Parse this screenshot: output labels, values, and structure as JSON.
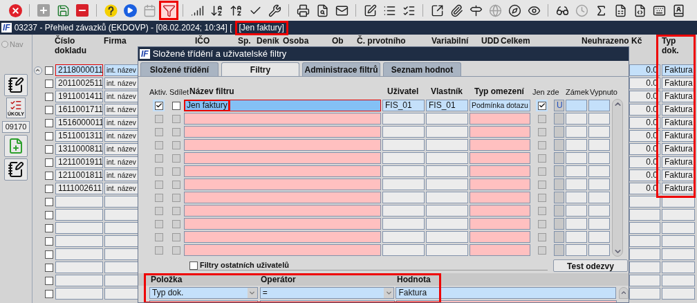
{
  "toolbar": {
    "items": [
      {
        "kind": "icon",
        "disabled": false,
        "highlighted": false
      },
      {
        "kind": "separator"
      },
      {
        "kind": "icon",
        "disabled": true,
        "highlighted": false
      },
      {
        "kind": "icon",
        "disabled": false,
        "highlighted": false
      },
      {
        "kind": "icon",
        "disabled": false,
        "highlighted": false
      },
      {
        "kind": "separator"
      },
      {
        "kind": "icon",
        "disabled": false,
        "highlighted": false
      },
      {
        "kind": "icon",
        "disabled": false,
        "highlighted": false
      },
      {
        "kind": "icon",
        "disabled": true,
        "highlighted": false
      },
      {
        "kind": "icon",
        "disabled": false,
        "highlighted": true
      },
      {
        "kind": "separator"
      },
      {
        "kind": "icon",
        "disabled": false,
        "highlighted": false
      },
      {
        "kind": "icon",
        "disabled": false,
        "highlighted": false
      },
      {
        "kind": "icon",
        "disabled": false,
        "highlighted": false
      },
      {
        "kind": "icon",
        "disabled": false,
        "highlighted": false
      },
      {
        "kind": "icon",
        "disabled": false,
        "highlighted": false
      },
      {
        "kind": "separator"
      },
      {
        "kind": "icon",
        "disabled": false,
        "highlighted": false
      },
      {
        "kind": "icon",
        "disabled": false,
        "highlighted": false
      },
      {
        "kind": "icon",
        "disabled": false,
        "highlighted": false
      },
      {
        "kind": "separator"
      },
      {
        "kind": "icon",
        "disabled": false,
        "highlighted": false
      },
      {
        "kind": "icon",
        "disabled": false,
        "highlighted": false
      },
      {
        "kind": "icon",
        "disabled": false,
        "highlighted": false
      },
      {
        "kind": "separator"
      },
      {
        "kind": "icon",
        "disabled": false,
        "highlighted": false
      },
      {
        "kind": "icon",
        "disabled": false,
        "highlighted": false
      },
      {
        "kind": "icon",
        "disabled": false,
        "highlighted": false
      },
      {
        "kind": "icon",
        "disabled": true,
        "highlighted": false
      },
      {
        "kind": "icon",
        "disabled": false,
        "highlighted": false
      },
      {
        "kind": "icon",
        "disabled": false,
        "highlighted": false
      },
      {
        "kind": "separator"
      },
      {
        "kind": "icon",
        "disabled": false,
        "highlighted": false
      },
      {
        "kind": "icon",
        "disabled": true,
        "highlighted": false
      },
      {
        "kind": "icon",
        "disabled": false,
        "highlighted": false
      },
      {
        "kind": "icon",
        "disabled": false,
        "highlighted": false
      },
      {
        "kind": "icon",
        "disabled": false,
        "highlighted": false
      },
      {
        "kind": "icon",
        "disabled": false,
        "highlighted": false
      },
      {
        "kind": "icon",
        "disabled": false,
        "highlighted": false
      }
    ]
  },
  "title_bar": {
    "logo": "IF",
    "title": "03237 - Přehled závazků (EKDOVP) - [08.02.2024; 10:34] [",
    "filter_label": "[Jen faktury]",
    "filter_highlighted": true
  },
  "sidebar": {
    "nav_label": "Nav",
    "nav_disabled": true,
    "tasks_label": "ÚKOLY",
    "code": "09170"
  },
  "table": {
    "columns": [
      {
        "label": "Číslo dokladu",
        "highlighted": false
      },
      {
        "label": "Firma",
        "highlighted": false
      },
      {
        "label": "IČO",
        "highlighted": false
      },
      {
        "label": "Sp.",
        "highlighted": false
      },
      {
        "label": "Deník",
        "highlighted": false
      },
      {
        "label": "Osoba",
        "highlighted": false
      },
      {
        "label": "Ob",
        "highlighted": false
      },
      {
        "label": "Č. prvotního",
        "highlighted": false
      },
      {
        "label": "Variabilní",
        "highlighted": false
      },
      {
        "label": "UDD",
        "highlighted": false
      },
      {
        "label": "Celkem",
        "highlighted": false
      },
      {
        "label": "Neuhrazeno Kč",
        "highlighted": false
      },
      {
        "label": "Typ dok.",
        "highlighted": true
      }
    ],
    "rows": [
      {
        "kind": "document",
        "checked": false,
        "number": "2118000011",
        "company": "int. název",
        "unpaid": "0.0",
        "type": "Faktura",
        "selected": true
      },
      {
        "kind": "document",
        "checked": false,
        "number": "2011002511",
        "company": "int. název",
        "unpaid": "0.0",
        "type": "Faktura",
        "selected": false
      },
      {
        "kind": "document",
        "checked": false,
        "number": "1911001411",
        "company": "int. název",
        "unpaid": "0.0",
        "type": "Faktura",
        "selected": false
      },
      {
        "kind": "document",
        "checked": false,
        "number": "1611001711",
        "company": "int. název",
        "unpaid": "0.0",
        "type": "Faktura",
        "selected": false
      },
      {
        "kind": "document",
        "checked": false,
        "number": "1516000011",
        "company": "int. název",
        "unpaid": "0.0",
        "type": "Faktura",
        "selected": false
      },
      {
        "kind": "document",
        "checked": false,
        "number": "1511001311",
        "company": "int. název",
        "unpaid": "0.0",
        "type": "Faktura",
        "selected": false
      },
      {
        "kind": "document",
        "checked": false,
        "number": "1311000811",
        "company": "int. název",
        "unpaid": "0.0",
        "type": "Faktura",
        "selected": false
      },
      {
        "kind": "document",
        "checked": false,
        "number": "1211001911",
        "company": "int. název",
        "unpaid": "0.0",
        "type": "Faktura",
        "selected": false
      },
      {
        "kind": "document",
        "checked": false,
        "number": "1211001811",
        "company": "int. název",
        "unpaid": "0.0",
        "type": "Faktura",
        "selected": false
      },
      {
        "kind": "document",
        "checked": false,
        "number": "1111002611",
        "company": "int. název",
        "unpaid": "0.0",
        "type": "Faktura",
        "selected": false
      },
      {
        "kind": "empty",
        "checked": false
      },
      {
        "kind": "empty",
        "checked": false
      },
      {
        "kind": "empty",
        "checked": false
      },
      {
        "kind": "empty",
        "checked": false
      },
      {
        "kind": "empty",
        "checked": false
      },
      {
        "kind": "empty",
        "checked": false
      },
      {
        "kind": "empty",
        "checked": false
      },
      {
        "kind": "empty",
        "checked": false
      }
    ]
  },
  "dialog": {
    "logo": "IF",
    "title": "Složené třídění a uživatelské filtry",
    "tabs": [
      {
        "label": "Složené třídění",
        "selected": false
      },
      {
        "label": "Filtry",
        "selected": true
      },
      {
        "label": "Administrace filtrů",
        "selected": false
      },
      {
        "label": "Seznam hodnot",
        "selected": false
      }
    ],
    "columns": [
      "Aktiv.",
      "Sdílet",
      "Název filtru",
      "Uživatel",
      "Vlastník",
      "Typ omezení",
      "Jen zde",
      "Zámek",
      "Vypnuto"
    ],
    "filters": [
      {
        "kind": "filter",
        "active": true,
        "shared": false,
        "name": "Jen faktury",
        "user": "FIS_01",
        "owner": "FIS_01",
        "restriction": "Podmínka dotazu",
        "local_only": true,
        "lock": "U",
        "selected": true,
        "highlighted": true
      },
      {
        "kind": "empty",
        "active": false,
        "shared": false,
        "local_only": false
      },
      {
        "kind": "empty",
        "active": false,
        "shared": false,
        "local_only": false
      },
      {
        "kind": "empty",
        "active": false,
        "shared": false,
        "local_only": false
      },
      {
        "kind": "empty",
        "active": false,
        "shared": false,
        "local_only": false
      },
      {
        "kind": "empty",
        "active": false,
        "shared": false,
        "local_only": false
      },
      {
        "kind": "empty",
        "active": false,
        "shared": false,
        "local_only": false
      },
      {
        "kind": "empty",
        "active": false,
        "shared": false,
        "local_only": false
      },
      {
        "kind": "empty",
        "active": false,
        "shared": false,
        "local_only": false
      },
      {
        "kind": "empty",
        "active": false,
        "shared": false,
        "local_only": false
      },
      {
        "kind": "empty",
        "active": false,
        "shared": false,
        "local_only": false
      },
      {
        "kind": "empty",
        "active": false,
        "shared": false,
        "local_only": false
      }
    ],
    "other_users": {
      "label": "Filtry ostatních uživatelů",
      "checked": false
    },
    "test_button": "Test odezvy",
    "conditions": {
      "highlighted": true,
      "columns": [
        "Položka",
        "Operátor",
        "Hodnota"
      ],
      "rows": [
        {
          "kind": "condition",
          "item": "Typ dok.",
          "operator": "=",
          "value": "Faktura"
        },
        {
          "kind": "empty"
        }
      ]
    }
  }
}
